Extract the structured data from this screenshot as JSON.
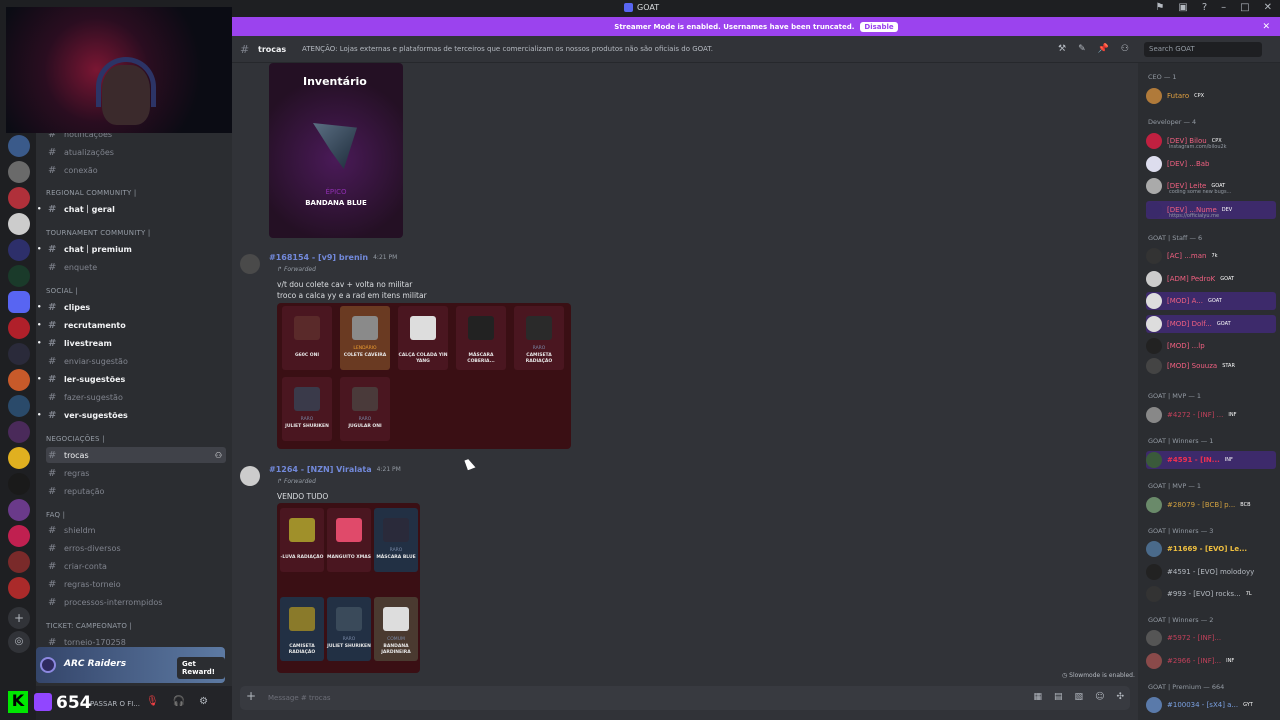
{
  "window": {
    "title": "GOAT"
  },
  "banner": {
    "text": "Streamer Mode is enabled. Usernames have been truncated.",
    "button": "Disable"
  },
  "header": {
    "channel": "trocas",
    "topic": "ATENÇÃO: Lojas externas e plataformas de terceiros que comercializam os nossos produtos não são oficiais do GOAT.",
    "search_placeholder": "Search GOAT"
  },
  "channels": {
    "top": [
      "notificações",
      "atualizações",
      "conexão"
    ],
    "cat_regional": "REGIONAL COMMUNITY |",
    "regional": [
      "chat｜geral"
    ],
    "cat_tournament": "TOURNAMENT COMMUNITY |",
    "tournament": [
      "chat｜premium",
      "enquete"
    ],
    "cat_social": "SOCIAL |",
    "social": [
      "clipes",
      "recrutamento",
      "livestream",
      "enviar-sugestão",
      "ler-sugestões",
      "fazer-sugestão",
      "ver-sugestões"
    ],
    "cat_neg": "NEGOCIAÇÕES |",
    "neg": [
      "trocas",
      "regras",
      "reputação"
    ],
    "cat_faq": "FAQ |",
    "faq": [
      "shieldm",
      "erros-diversos",
      "criar-conta",
      "regras-torneio",
      "processos-interrompidos"
    ],
    "cat_ticket": "TICKET: CAMPEONATO |",
    "ticket": [
      "torneio-170258"
    ]
  },
  "reward": {
    "name": "ARC Raiders",
    "button": "Get Reward!"
  },
  "userbar": {
    "count": "654",
    "status": "PASSAR O FI..."
  },
  "messages": {
    "inventory": {
      "title": "Inventário",
      "rarity": "ÉPICO",
      "item": "BANDANA BLUE"
    },
    "m1": {
      "user": "#168154 - [v9] brenin",
      "time": "4:21 PM",
      "forwarded": "Forwarded",
      "line1": "v/t dou colete cav + volta no militar",
      "line2": "troco a calca yy e a rad em itens militar"
    },
    "m1_items": [
      {
        "rarity": "",
        "name": "G60C ONI"
      },
      {
        "rarity": "LENDÁRIO",
        "name": "COLETE CAVEIRA"
      },
      {
        "rarity": "",
        "name": "CALÇA COLADA YIN YANG"
      },
      {
        "rarity": "",
        "name": "MÁSCARA COBERIA..."
      },
      {
        "rarity": "RARO",
        "name": "CAMISETA RADIAÇÃO"
      },
      {
        "rarity": "RARO",
        "name": "JULIET SHURIKEN"
      },
      {
        "rarity": "RARO",
        "name": "JUGULAR ONI"
      }
    ],
    "m2": {
      "user": "#1264 - [NZN] Viralata",
      "time": "4:21 PM",
      "forwarded": "Forwarded",
      "line1": "VENDO TUDO"
    },
    "m2_items": [
      {
        "rarity": "",
        "name": "-LUVA RADIAÇÃO"
      },
      {
        "rarity": "",
        "name": "MANGUITO XMAS"
      },
      {
        "rarity": "RARO",
        "name": "MÁSCARA BLUE"
      },
      {
        "rarity": "",
        "name": "CAMISETA RADIAÇÃO"
      },
      {
        "rarity": "RARO",
        "name": "JULIET SHURIKEN"
      },
      {
        "rarity": "COMUM",
        "name": "BANDANA JARDINEIRA"
      }
    ],
    "slowmode": "Slowmode is enabled."
  },
  "input": {
    "placeholder": "Message # trocas"
  },
  "members": {
    "cat1": "CEO — 1",
    "m_ceo": {
      "name": "Futaro",
      "badge": "CPX"
    },
    "cat2": "Developer — 4",
    "dev": [
      {
        "name": "[DEV] Bilou",
        "badge": "CPX",
        "sub": "instagram.com/bilou2k"
      },
      {
        "name": "[DEV] ...Bab",
        "badge": "",
        "sub": ""
      },
      {
        "name": "[DEV] Leite",
        "badge": "GOAT",
        "sub": "coding some new bugs..."
      },
      {
        "name": "[DEV] ...Nume",
        "badge": "DEV",
        "sub": "https://officialyu.me"
      }
    ],
    "cat3": "GOAT | Staff — 6",
    "staff": [
      {
        "name": "[AC] ...man",
        "badge": "7k"
      },
      {
        "name": "[ADM] PedroK",
        "badge": "GOAT"
      },
      {
        "name": "[MOD] A...",
        "badge": "GOAT"
      },
      {
        "name": "[MOD] Dolf...",
        "badge": "GOAT"
      },
      {
        "name": "[MOD] ...lp",
        "badge": ""
      },
      {
        "name": "[MOD] Souuza",
        "badge": "STAR"
      }
    ],
    "cat4": "GOAT | MVP — 1",
    "mvp1": {
      "name": "#4272 - [INF] ...",
      "badge": "INF"
    },
    "cat5": "GOAT | Winners — 1",
    "win1": {
      "name": "#4591 - [IN...",
      "badge": "INF"
    },
    "cat6": "GOAT | MVP — 1",
    "mvp2": {
      "name": "#28079 - [BCB] p...",
      "badge": "BCB"
    },
    "cat7": "GOAT | Winners — 3",
    "win3": [
      {
        "name": "#11669 - [EVO] Le...",
        "badge": ""
      },
      {
        "name": "#4591 - [EVO] molodoyy",
        "badge": ""
      },
      {
        "name": "#993 - [EVO] rocks...",
        "badge": "7L"
      }
    ],
    "cat8": "GOAT | Winners — 2",
    "win2": [
      {
        "name": "#5972 - [INF]...",
        "badge": ""
      },
      {
        "name": "#2966 - [INF]...",
        "badge": "INF"
      }
    ],
    "cat9": "GOAT | Premium — 664",
    "prem": {
      "name": "#100034 - [sX4] a...",
      "badge": "GYT"
    }
  }
}
